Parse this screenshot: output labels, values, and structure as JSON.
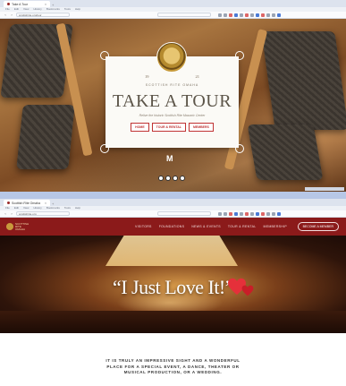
{
  "browser1": {
    "tab_title": "Take A Tour",
    "url": "scottishrite.org/tour",
    "menu": [
      "File",
      "Edit",
      "View",
      "History",
      "Bookmarks",
      "Tools",
      "Help"
    ]
  },
  "tour": {
    "year_left": "19",
    "year_right": "21",
    "kicker": "SCOTTISH RITE OMAHA",
    "title": "TAKE A TOUR",
    "subtitle": "Relive the historic Scottish Rite Masonic Center",
    "buttons": [
      "HOME",
      "TOUR & RENTAL",
      "MEMBERS"
    ],
    "logo": "M"
  },
  "browser2": {
    "tab_title": "Scottish Rite Omaha",
    "url": "scottishrite.org",
    "menu": [
      "File",
      "Edit",
      "View",
      "History",
      "Bookmarks",
      "Tools",
      "Help"
    ]
  },
  "site": {
    "brand": "SCOTTISH RITE OMAHA",
    "nav": [
      "VISITORS",
      "FOUNDATIONS",
      "NEWS & EVENTS",
      "TOUR & RENTAL",
      "MEMBERSHIP"
    ],
    "cta": "BECOME A MEMBER",
    "quote": "“I Just Love It!”",
    "tagline": "IT IS TRULY AN IMPRESSIVE SIGHT AND A WONDERFUL PLACE FOR A SPECIAL EVENT, A DANCE, THEATER OR MUSICAL PRODUCTION, OR A WEDDING."
  },
  "colors": {
    "brand_red": "#8b1a1a",
    "accent_red": "#c03333",
    "heart_red": "#e5303a"
  }
}
